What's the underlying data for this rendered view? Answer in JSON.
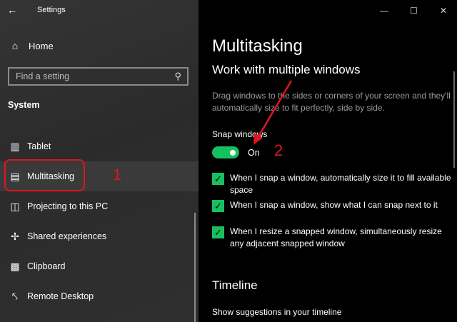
{
  "window": {
    "title": "Settings",
    "controls": {
      "minimize": "—",
      "maximize": "☐",
      "close": "✕"
    }
  },
  "sidebar": {
    "home_label": "Home",
    "search_placeholder": "Find a setting",
    "section_title": "System",
    "items": [
      {
        "label": "Tablet",
        "icon": "tablet-icon"
      },
      {
        "label": "Multitasking",
        "icon": "multitasking-icon",
        "active": true
      },
      {
        "label": "Projecting to this PC",
        "icon": "projecting-icon"
      },
      {
        "label": "Shared experiences",
        "icon": "shared-experiences-icon"
      },
      {
        "label": "Clipboard",
        "icon": "clipboard-icon"
      },
      {
        "label": "Remote Desktop",
        "icon": "remote-desktop-icon"
      }
    ]
  },
  "main": {
    "page_title": "Multitasking",
    "subtitle": "Work with multiple windows",
    "description": "Drag windows to the sides or corners of your screen and they'll automatically size to fit perfectly, side by side.",
    "snap_label": "Snap windows",
    "toggle_state": "On",
    "checkboxes": [
      {
        "label": "When I snap a window, automatically size it to fill available space",
        "checked": true
      },
      {
        "label": "When I snap a window, show what I can snap next to it",
        "checked": true
      },
      {
        "label": "When I resize a snapped window, simultaneously resize any adjacent snapped window",
        "checked": true
      }
    ],
    "timeline_title": "Timeline",
    "timeline_option": "Show suggestions in your timeline"
  },
  "annotations": {
    "num1": "1",
    "num2": "2"
  },
  "colors": {
    "accent": "#16c060",
    "annotation": "#e0161e",
    "sidebar_bg": "#2b2b2b",
    "content_bg": "#000000"
  }
}
